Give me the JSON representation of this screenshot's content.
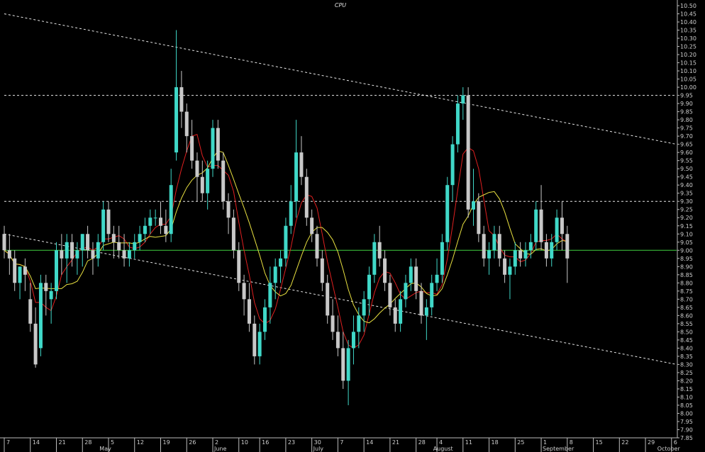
{
  "chart_data": {
    "type": "candlestick",
    "title": "CPU",
    "ylim": [
      7.85,
      10.5
    ],
    "y_ticks": [
      7.85,
      7.9,
      7.95,
      8.0,
      8.05,
      8.1,
      8.15,
      8.2,
      8.25,
      8.3,
      8.35,
      8.4,
      8.45,
      8.5,
      8.55,
      8.6,
      8.65,
      8.7,
      8.75,
      8.8,
      8.85,
      8.9,
      8.95,
      9.0,
      9.05,
      9.1,
      9.15,
      9.2,
      9.25,
      9.3,
      9.35,
      9.4,
      9.45,
      9.5,
      9.55,
      9.6,
      9.65,
      9.7,
      9.75,
      9.8,
      9.85,
      9.9,
      9.95,
      10.0,
      10.05,
      10.1,
      10.15,
      10.2,
      10.25,
      10.3,
      10.35,
      10.4,
      10.45,
      10.5
    ],
    "x_day_ticks": [
      {
        "label": "7",
        "i": 0
      },
      {
        "label": "14",
        "i": 5
      },
      {
        "label": "21",
        "i": 10
      },
      {
        "label": "28",
        "i": 15
      },
      {
        "label": "5",
        "i": 20
      },
      {
        "label": "12",
        "i": 25
      },
      {
        "label": "19",
        "i": 30
      },
      {
        "label": "26",
        "i": 35
      },
      {
        "label": "2",
        "i": 40
      },
      {
        "label": "10",
        "i": 45
      },
      {
        "label": "16",
        "i": 49
      },
      {
        "label": "23",
        "i": 54
      },
      {
        "label": "30",
        "i": 59
      },
      {
        "label": "7",
        "i": 64
      },
      {
        "label": "14",
        "i": 69
      },
      {
        "label": "21",
        "i": 74
      },
      {
        "label": "28",
        "i": 79
      },
      {
        "label": "4",
        "i": 83
      },
      {
        "label": "11",
        "i": 88
      },
      {
        "label": "18",
        "i": 93
      },
      {
        "label": "25",
        "i": 98
      },
      {
        "label": "1",
        "i": 103
      },
      {
        "label": "8",
        "i": 108
      },
      {
        "label": "15",
        "i": 113
      },
      {
        "label": "22",
        "i": 118
      },
      {
        "label": "29",
        "i": 123
      },
      {
        "label": "6",
        "i": 128
      }
    ],
    "x_month_ticks": [
      {
        "label": "May",
        "i": 18
      },
      {
        "label": "June",
        "i": 40
      },
      {
        "label": "July",
        "i": 59
      },
      {
        "label": "August",
        "i": 82
      },
      {
        "label": "September",
        "i": 103
      },
      {
        "label": "October",
        "i": 125
      }
    ],
    "candles": [
      [
        9.1,
        9.15,
        8.95,
        9.0
      ],
      [
        9.0,
        9.1,
        8.85,
        8.95
      ],
      [
        8.95,
        9.0,
        8.75,
        8.8
      ],
      [
        8.8,
        8.9,
        8.7,
        8.9
      ],
      [
        8.9,
        8.95,
        8.75,
        8.85
      ],
      [
        8.7,
        8.8,
        8.5,
        8.55
      ],
      [
        8.55,
        8.65,
        8.28,
        8.3
      ],
      [
        8.4,
        8.85,
        8.35,
        8.8
      ],
      [
        8.8,
        8.85,
        8.6,
        8.75
      ],
      [
        8.7,
        8.8,
        8.55,
        8.75
      ],
      [
        8.75,
        9.05,
        8.7,
        9.0
      ],
      [
        9.0,
        9.1,
        8.85,
        8.95
      ],
      [
        8.95,
        9.1,
        8.8,
        9.05
      ],
      [
        9.05,
        9.1,
        8.9,
        8.95
      ],
      [
        8.95,
        9.05,
        8.85,
        9.0
      ],
      [
        9.0,
        9.1,
        8.9,
        9.1
      ],
      [
        9.1,
        9.15,
        8.95,
        9.0
      ],
      [
        9.0,
        9.05,
        8.85,
        8.95
      ],
      [
        8.95,
        9.1,
        8.9,
        9.05
      ],
      [
        9.05,
        9.3,
        9.0,
        9.25
      ],
      [
        9.25,
        9.3,
        9.05,
        9.1
      ],
      [
        9.1,
        9.15,
        8.95,
        9.05
      ],
      [
        9.05,
        9.15,
        8.95,
        9.0
      ],
      [
        9.0,
        9.1,
        8.9,
        8.95
      ],
      [
        8.95,
        9.05,
        8.9,
        9.0
      ],
      [
        9.0,
        9.1,
        8.95,
        9.05
      ],
      [
        9.05,
        9.15,
        9.0,
        9.1
      ],
      [
        9.1,
        9.2,
        9.05,
        9.15
      ],
      [
        9.15,
        9.25,
        9.1,
        9.2
      ],
      [
        9.2,
        9.25,
        9.15,
        9.2
      ],
      [
        9.2,
        9.3,
        9.1,
        9.15
      ],
      [
        9.15,
        9.25,
        9.05,
        9.1
      ],
      [
        9.1,
        9.5,
        9.05,
        9.4
      ],
      [
        9.6,
        10.35,
        9.55,
        10.0
      ],
      [
        10.0,
        10.1,
        9.75,
        9.85
      ],
      [
        9.85,
        9.9,
        9.6,
        9.7
      ],
      [
        9.7,
        9.8,
        9.5,
        9.55
      ],
      [
        9.55,
        9.6,
        9.3,
        9.45
      ],
      [
        9.45,
        9.55,
        9.3,
        9.35
      ],
      [
        9.35,
        9.55,
        9.25,
        9.5
      ],
      [
        9.5,
        9.8,
        9.45,
        9.75
      ],
      [
        9.75,
        9.8,
        9.5,
        9.55
      ],
      [
        9.55,
        9.6,
        9.25,
        9.3
      ],
      [
        9.3,
        9.35,
        9.1,
        9.2
      ],
      [
        9.2,
        9.25,
        8.95,
        9.0
      ],
      [
        9.0,
        9.05,
        8.75,
        8.8
      ],
      [
        8.8,
        8.85,
        8.6,
        8.7
      ],
      [
        8.7,
        8.8,
        8.5,
        8.55
      ],
      [
        8.55,
        8.6,
        8.3,
        8.35
      ],
      [
        8.35,
        8.55,
        8.3,
        8.5
      ],
      [
        8.5,
        8.7,
        8.45,
        8.65
      ],
      [
        8.65,
        8.9,
        8.55,
        8.8
      ],
      [
        8.8,
        8.95,
        8.7,
        8.9
      ],
      [
        8.9,
        9.0,
        8.8,
        8.95
      ],
      [
        8.95,
        9.2,
        8.9,
        9.15
      ],
      [
        9.15,
        9.4,
        9.1,
        9.3
      ],
      [
        9.3,
        9.8,
        9.2,
        9.6
      ],
      [
        9.6,
        9.7,
        9.4,
        9.45
      ],
      [
        9.45,
        9.5,
        9.15,
        9.2
      ],
      [
        9.2,
        9.25,
        9.05,
        9.1
      ],
      [
        9.1,
        9.15,
        8.9,
        8.95
      ],
      [
        8.95,
        9.0,
        8.75,
        8.8
      ],
      [
        8.8,
        8.85,
        8.55,
        8.6
      ],
      [
        8.6,
        8.7,
        8.45,
        8.5
      ],
      [
        8.5,
        8.6,
        8.35,
        8.4
      ],
      [
        8.4,
        8.5,
        8.15,
        8.2
      ],
      [
        8.2,
        8.45,
        8.05,
        8.4
      ],
      [
        8.4,
        8.6,
        8.3,
        8.5
      ],
      [
        8.5,
        8.65,
        8.4,
        8.6
      ],
      [
        8.6,
        8.75,
        8.5,
        8.7
      ],
      [
        8.7,
        8.9,
        8.6,
        8.85
      ],
      [
        8.85,
        9.1,
        8.8,
        9.05
      ],
      [
        9.05,
        9.15,
        8.9,
        8.95
      ],
      [
        8.95,
        9.0,
        8.75,
        8.8
      ],
      [
        8.8,
        8.85,
        8.6,
        8.65
      ],
      [
        8.65,
        8.7,
        8.5,
        8.55
      ],
      [
        8.55,
        8.75,
        8.5,
        8.7
      ],
      [
        8.7,
        8.85,
        8.65,
        8.8
      ],
      [
        8.8,
        8.95,
        8.75,
        8.9
      ],
      [
        8.9,
        8.95,
        8.7,
        8.75
      ],
      [
        8.75,
        8.8,
        8.55,
        8.6
      ],
      [
        8.6,
        8.7,
        8.45,
        8.65
      ],
      [
        8.65,
        8.85,
        8.6,
        8.8
      ],
      [
        8.8,
        8.95,
        8.75,
        8.85
      ],
      [
        8.85,
        9.1,
        8.8,
        9.05
      ],
      [
        9.05,
        9.45,
        9.0,
        9.4
      ],
      [
        9.4,
        9.7,
        9.3,
        9.65
      ],
      [
        9.65,
        9.95,
        9.6,
        9.9
      ],
      [
        9.9,
        10.0,
        9.8,
        9.95
      ],
      [
        9.95,
        10.0,
        9.2,
        9.25
      ],
      [
        9.25,
        9.5,
        9.15,
        9.3
      ],
      [
        9.3,
        9.35,
        9.05,
        9.1
      ],
      [
        9.1,
        9.15,
        8.9,
        8.95
      ],
      [
        8.95,
        9.05,
        8.85,
        9.0
      ],
      [
        9.0,
        9.15,
        8.95,
        9.1
      ],
      [
        9.1,
        9.15,
        8.9,
        8.95
      ],
      [
        8.95,
        9.0,
        8.8,
        8.85
      ],
      [
        8.85,
        8.95,
        8.7,
        8.9
      ],
      [
        8.9,
        9.05,
        8.85,
        9.0
      ],
      [
        9.0,
        9.05,
        8.9,
        8.95
      ],
      [
        8.95,
        9.05,
        8.9,
        9.0
      ],
      [
        9.0,
        9.1,
        8.95,
        9.05
      ],
      [
        9.05,
        9.3,
        9.0,
        9.25
      ],
      [
        9.25,
        9.4,
        9.0,
        9.05
      ],
      [
        9.05,
        9.1,
        8.9,
        8.95
      ],
      [
        8.95,
        9.1,
        8.9,
        9.05
      ],
      [
        9.05,
        9.25,
        9.0,
        9.2
      ],
      [
        9.2,
        9.3,
        9.0,
        9.1
      ],
      [
        9.1,
        9.15,
        8.8,
        8.95
      ]
    ],
    "lines": [
      {
        "color": "#e8e8e8",
        "dash": "3,3",
        "p": [
          [
            0,
            10.45
          ],
          [
            130,
            9.65
          ]
        ]
      },
      {
        "color": "#e8e8e8",
        "dash": "3,3",
        "p": [
          [
            0,
            9.1
          ],
          [
            130,
            8.3
          ]
        ]
      },
      {
        "color": "#e8e8e8",
        "dash": "3,3",
        "p": [
          [
            0,
            9.95
          ],
          [
            130,
            9.95
          ]
        ]
      },
      {
        "color": "#e8e8e8",
        "dash": "3,3",
        "p": [
          [
            0,
            9.3
          ],
          [
            130,
            9.3
          ]
        ]
      },
      {
        "color": "#40d040",
        "dash": "",
        "p": [
          [
            0,
            9.0
          ],
          [
            130,
            9.0
          ]
        ]
      }
    ],
    "colors": {
      "up": "#40d8c8",
      "down": "#c8c8c8",
      "ma_fast": "#e02020",
      "ma_slow": "#e8e040"
    }
  }
}
